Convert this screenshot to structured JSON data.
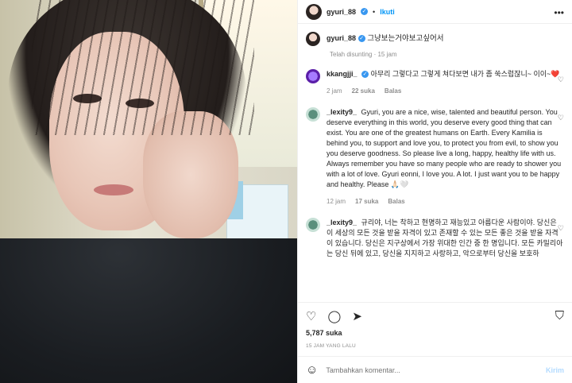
{
  "post": {
    "username": "gyuri_88",
    "follow_label": "Ikuti",
    "more_label": "•••",
    "caption": "그냥보는거야보고싶어서",
    "caption_meta": "Telah disunting · 15 jam"
  },
  "comments": [
    {
      "username": "kkangjji_",
      "verified": true,
      "text": "아무리 그렇다고 그렇게 쳐다보면 내가 좀 쑥스럽잖니~ 이이~❤️",
      "time": "2 jam",
      "likes": "22 suka",
      "reply": "Balas"
    },
    {
      "username": "_lexity9_",
      "verified": false,
      "text": "Gyuri, you are a nice, wise, talented and beautiful person. You deserve everything in this world, you deserve every good thing that can exist. You are one of the greatest humans on Earth. Every Kamilia is behind you, to support and love you, to protect you from evil, to show you you deserve goodness. So please live a long, happy, healthy life with us. Always remember you have so many people who are ready to shower you with a lot of love. Gyuri eonni, I love you. A lot. I just want you to be happy and healthy. Please 🙏🏻🤍",
      "time": "12 jam",
      "likes": "17 suka",
      "reply": "Balas"
    },
    {
      "username": "_lexity9_",
      "verified": false,
      "text": "규리야, 너는 착하고 현명하고 재능있고 아름다운 사람이야. 당신은 이 세상의 모든 것을 받을 자격이 있고 존재할 수 있는 모든 좋은 것을 받을 자격이 있습니다. 당신은 지구상에서 가장 위대한 인간 중 한 명입니다. 모든 카밀리아는 당신 뒤에 있고, 당신을 지지하고 사랑하고, 악으로부터 당신을 보호하",
      "time": "",
      "likes": "",
      "reply": ""
    }
  ],
  "likes_count": "5,787 suka",
  "posted_ago": "15 JAM YANG LALU",
  "add_comment": {
    "placeholder": "Tambahkan komentar...",
    "send_label": "Kirim"
  },
  "icons": [
    "heart-icon",
    "comment-icon",
    "share-icon",
    "bookmark-icon",
    "emoji-icon",
    "more-icon",
    "verified-icon"
  ]
}
